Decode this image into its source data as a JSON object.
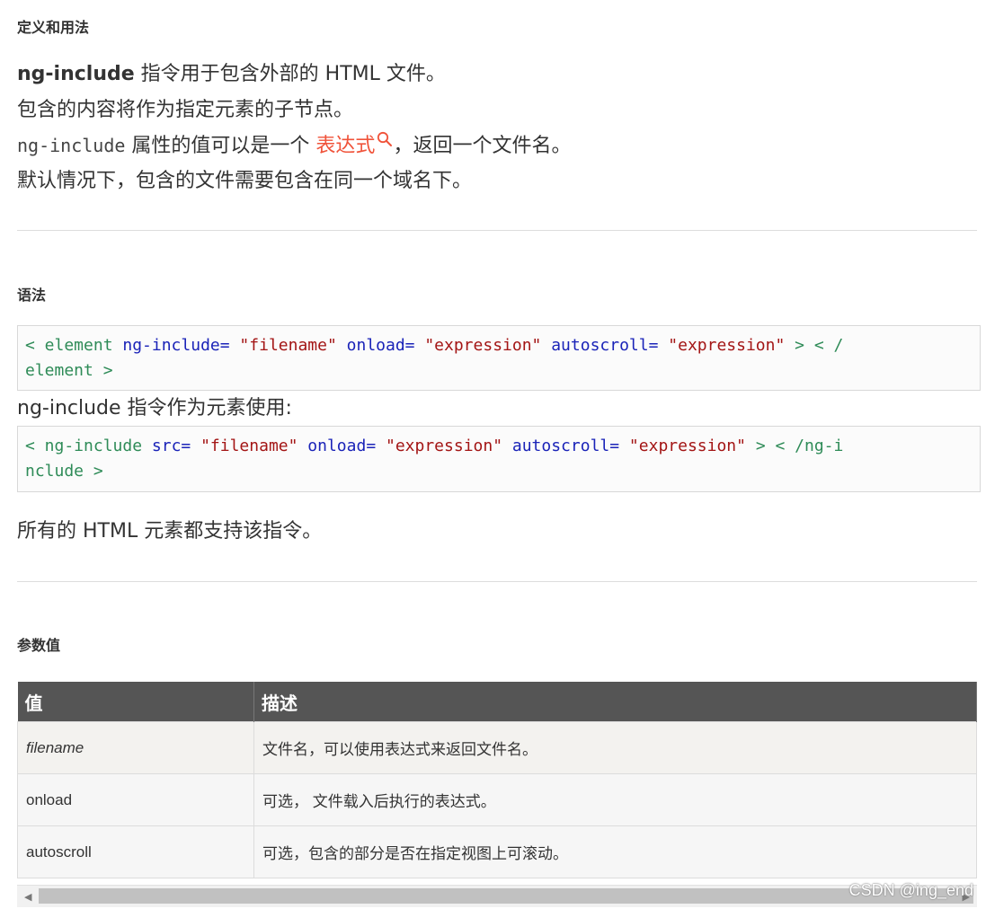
{
  "section1": {
    "heading": "定义和用法",
    "line1_bold": "ng-include",
    "line1_rest": " 指令用于包含外部的 HTML 文件。",
    "line2": "包含的内容将作为指定元素的子节点。",
    "line3_code": "ng-include",
    "line3_mid": " 属性的值可以是一个 ",
    "line3_link": "表达式",
    "line3_end": "，返回一个文件名。",
    "line4": "默认情况下，包含的文件需要包含在同一个域名下。"
  },
  "section2": {
    "heading": "语法",
    "code1": {
      "line1": [
        "< element  ",
        "ng-include=",
        " \"filename\"  ",
        "onload=",
        " \"expression\"  ",
        "autoscroll=",
        " \"expression\"  ",
        "> < /"
      ],
      "line2": "element >"
    },
    "mid_text": "ng-include 指令作为元素使用:",
    "code2": {
      "line1": [
        "< ng-include  ",
        "src=",
        " \"filename\"  ",
        "onload=",
        " \"expression\"  ",
        "autoscroll=",
        " \"expression\"  ",
        "> < /ng-i"
      ],
      "line2": "nclude >"
    },
    "support_text": "所有的 HTML 元素都支持该指令。"
  },
  "section3": {
    "heading": "参数值",
    "table": {
      "headers": [
        "值",
        "描述"
      ],
      "rows": [
        {
          "value": "filename",
          "desc": "文件名，可以使用表达式来返回文件名。"
        },
        {
          "value": "onload",
          "desc": "可选， 文件载入后执行的表达式。"
        },
        {
          "value": "autoscroll",
          "desc": "可选，包含的部分是否在指定视图上可滚动。"
        }
      ]
    }
  },
  "watermark": "CSDN @ing_end",
  "colors": {
    "link": "#f0533a",
    "table_header": "#555555"
  },
  "icons": {
    "search": "search-icon"
  }
}
